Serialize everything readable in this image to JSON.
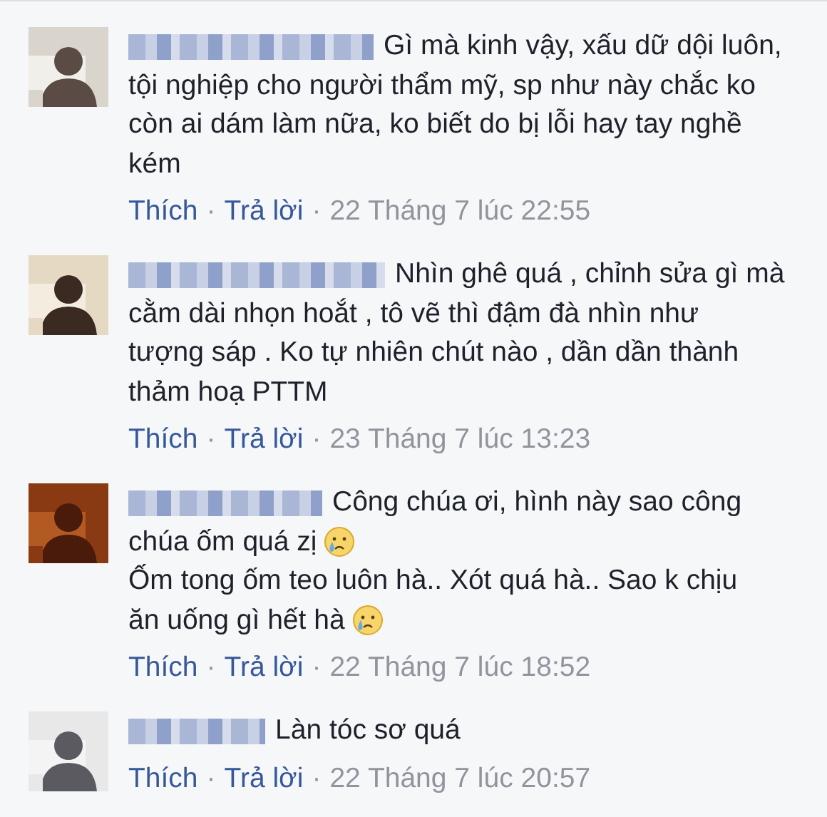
{
  "comments": [
    {
      "lines": [
        {
          "text": "Gì mà kinh vậy, xấu dữ dội luôn,",
          "emoji": false
        },
        {
          "text": "tội nghiệp cho người thẩm mỹ, sp như này chắc ko",
          "emoji": false
        },
        {
          "text": "còn ai dám làm nữa, ko biết do bị lỗi hay tay nghề",
          "emoji": false
        },
        {
          "text": "kém",
          "emoji": false
        }
      ],
      "like": "Thích",
      "reply": "Trả lời",
      "separators": [
        "·",
        "·"
      ],
      "time": "22 Tháng 7 lúc 22:55"
    },
    {
      "lines": [
        {
          "text": "Nhìn ghê quá , chỉnh sửa gì mà",
          "emoji": false
        },
        {
          "text": "cằm dài nhọn hoắt , tô vẽ thì đậm đà nhìn như",
          "emoji": false
        },
        {
          "text": "tượng sáp . Ko tự nhiên chút nào , dần dần thành",
          "emoji": false
        },
        {
          "text": "thảm hoạ PTTM",
          "emoji": false
        }
      ],
      "like": "Thích",
      "reply": "Trả lời",
      "separators": [
        "·",
        "·"
      ],
      "time": "23 Tháng 7 lúc 13:23"
    },
    {
      "lines": [
        {
          "text": "Công chúa ơi, hình này sao công",
          "emoji": false
        },
        {
          "text": "chúa ốm quá zị",
          "emoji": true
        },
        {
          "text": "Ốm tong ốm teo luôn hà.. Xót quá hà.. Sao k chịu",
          "emoji": false
        },
        {
          "text": "ăn uống gì hết hà",
          "emoji": true
        }
      ],
      "like": "Thích",
      "reply": "Trả lời",
      "separators": [
        "·",
        "·"
      ],
      "time": "22 Tháng 7 lúc 18:52"
    },
    {
      "lines": [
        {
          "text": "Làn tóc sơ quá",
          "emoji": false
        }
      ],
      "like": "Thích",
      "reply": "Trả lời",
      "separators": [
        "·",
        "·"
      ],
      "time": "22 Tháng 7 lúc 20:57"
    }
  ]
}
